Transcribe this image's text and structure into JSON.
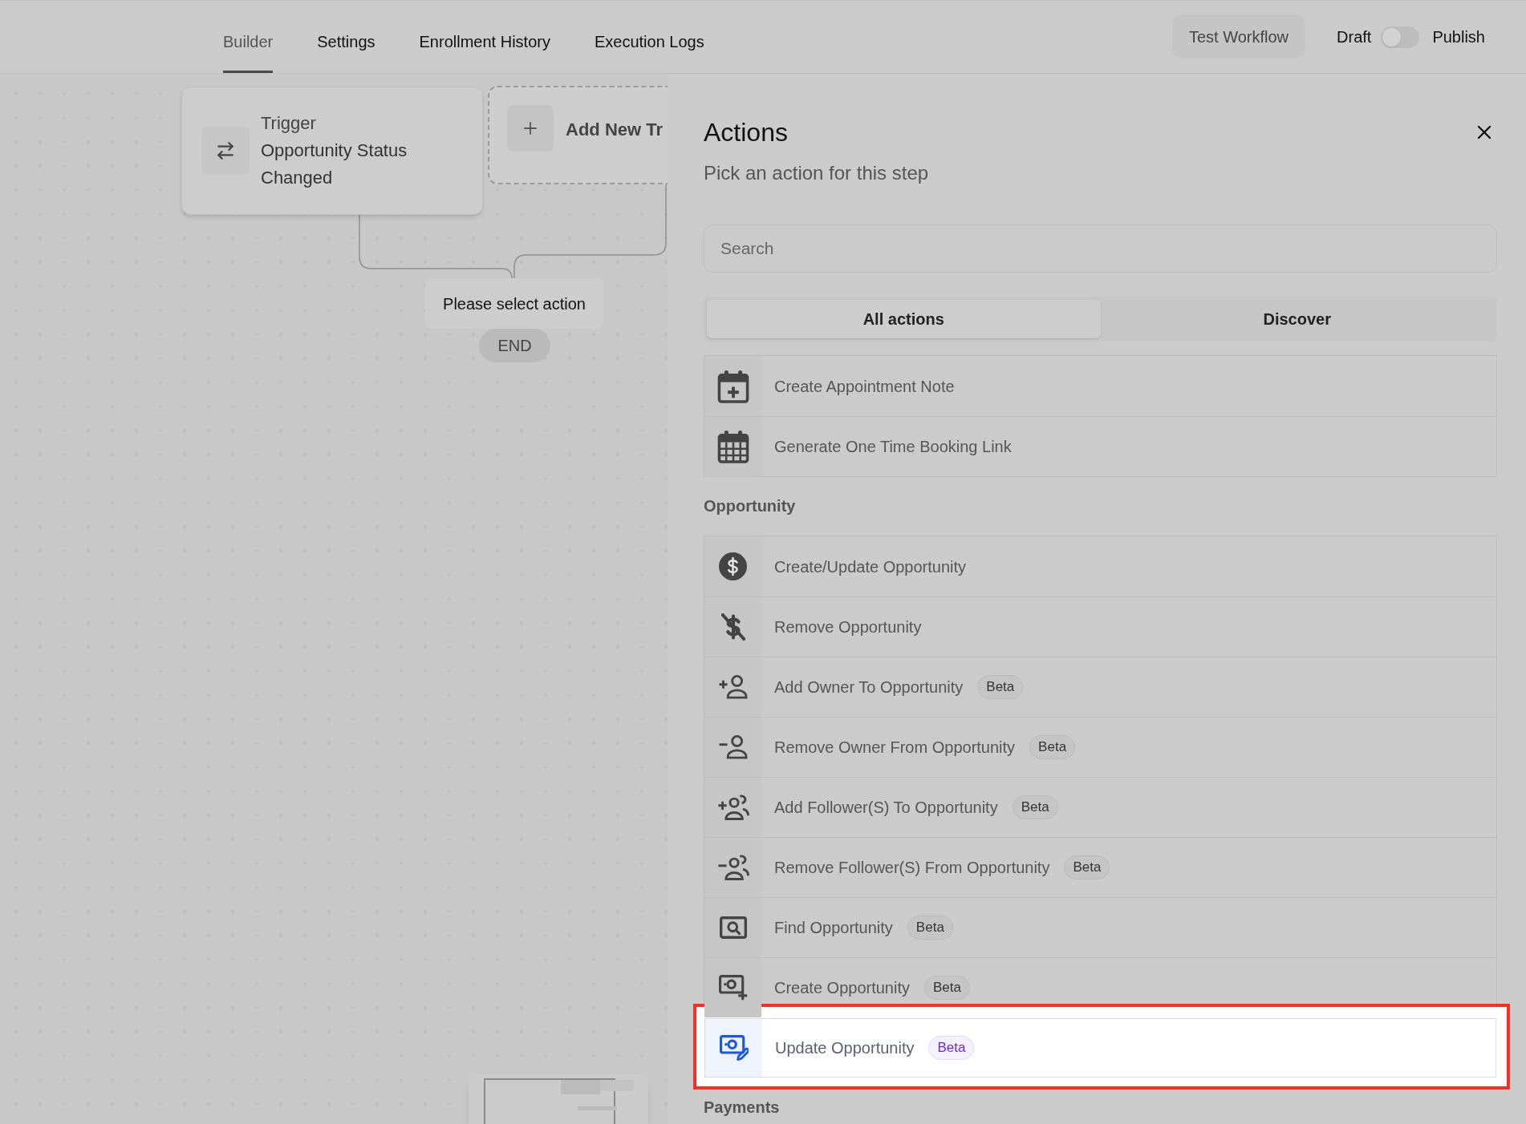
{
  "top_nav": {
    "tabs": [
      {
        "label": "Builder",
        "selected": true
      },
      {
        "label": "Settings",
        "selected": false
      },
      {
        "label": "Enrollment History",
        "selected": false
      },
      {
        "label": "Execution Logs",
        "selected": false
      }
    ],
    "test_button": "Test Workflow",
    "draft_label": "Draft",
    "publish_toggle": {
      "on": false
    },
    "publish_label": "Publish"
  },
  "canvas": {
    "trigger_node": {
      "title": "Trigger",
      "subtitle": "Opportunity Status Changed"
    },
    "add_trigger_node": {
      "label": "Add New Tr"
    },
    "action_node": {
      "label": "Please select action"
    },
    "end_node": {
      "label": "END"
    }
  },
  "actions_panel": {
    "title": "Actions",
    "subtitle": "Pick an action for this step",
    "search": {
      "placeholder": "Search"
    },
    "tabs": [
      {
        "label": "All actions",
        "selected": true
      },
      {
        "label": "Discover",
        "selected": false
      }
    ],
    "groups": [
      {
        "items": [
          {
            "label": "Create Appointment Note",
            "selected": false
          },
          {
            "label": "Generate One Time Booking Link",
            "selected": false
          }
        ]
      },
      {
        "heading": "Opportunity",
        "items": [
          {
            "label": "Create/Update Opportunity",
            "selected": false
          },
          {
            "label": "Remove Opportunity",
            "selected": false
          },
          {
            "label": "Add Owner To Opportunity",
            "badge": "Beta",
            "selected": false
          },
          {
            "label": "Remove Owner From Opportunity",
            "badge": "Beta",
            "selected": false
          },
          {
            "label": "Add Follower(S) To Opportunity",
            "badge": "Beta",
            "selected": false
          },
          {
            "label": "Remove Follower(S) From Opportunity",
            "badge": "Beta",
            "selected": false
          },
          {
            "label": "Find Opportunity",
            "badge": "Beta",
            "selected": false
          },
          {
            "label": "Create Opportunity",
            "badge": "Beta",
            "selected": false
          },
          {
            "label": "Update Opportunity",
            "badge": "Beta",
            "selected": true
          }
        ]
      },
      {
        "heading": "Payments"
      }
    ]
  }
}
